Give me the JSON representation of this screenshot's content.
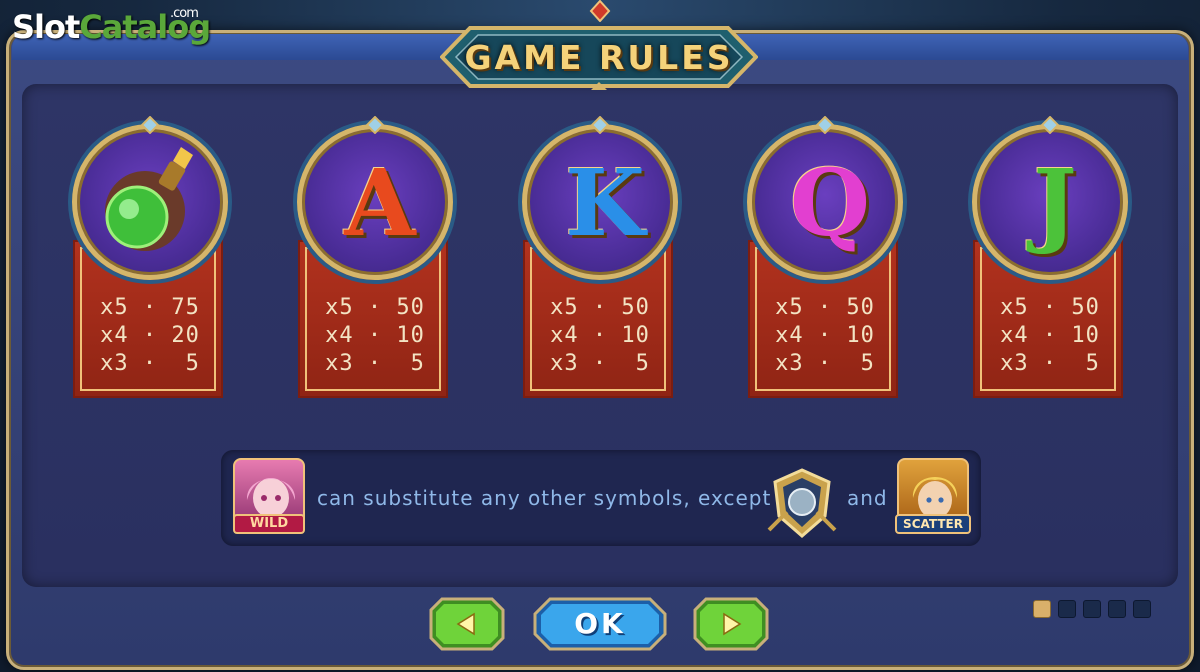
{
  "logo": {
    "slot": "Slot",
    "catalog": "Catalog",
    "com": ".com"
  },
  "title": "GAME RULES",
  "symbols": [
    {
      "name": "potion",
      "icon": "potion-bomb-icon",
      "pays": [
        "x5 · 75",
        "x4 · 20",
        "x3 ·  5"
      ]
    },
    {
      "name": "A",
      "letter": "A",
      "color": "#e84a1e",
      "pays": [
        "x5 · 50",
        "x4 · 10",
        "x3 ·  5"
      ]
    },
    {
      "name": "K",
      "letter": "K",
      "color": "#2a8fe8",
      "pays": [
        "x5 · 50",
        "x4 · 10",
        "x3 ·  5"
      ]
    },
    {
      "name": "Q",
      "letter": "Q",
      "color": "#e23fd0",
      "pays": [
        "x5 · 50",
        "x4 · 10",
        "x3 ·  5"
      ]
    },
    {
      "name": "J",
      "letter": "J",
      "color": "#4cc23a",
      "pays": [
        "x5 · 50",
        "x4 · 10",
        "x3 ·  5"
      ]
    }
  ],
  "wild": {
    "label": "WILD",
    "text": "can substitute any other symbols, except",
    "and": "and",
    "scatter_label": "SCATTER"
  },
  "buttons": {
    "prev_icon": "arrow-left-icon",
    "ok": "OK",
    "next_icon": "arrow-right-icon"
  },
  "pagination": {
    "pages": 5,
    "current": 1
  },
  "colors": {
    "panel": "#2e3566",
    "frame_gold": "#c8b07a",
    "banner_red": "#b2321e",
    "ok_blue": "#2a9be8",
    "nav_green": "#5fc22e"
  }
}
